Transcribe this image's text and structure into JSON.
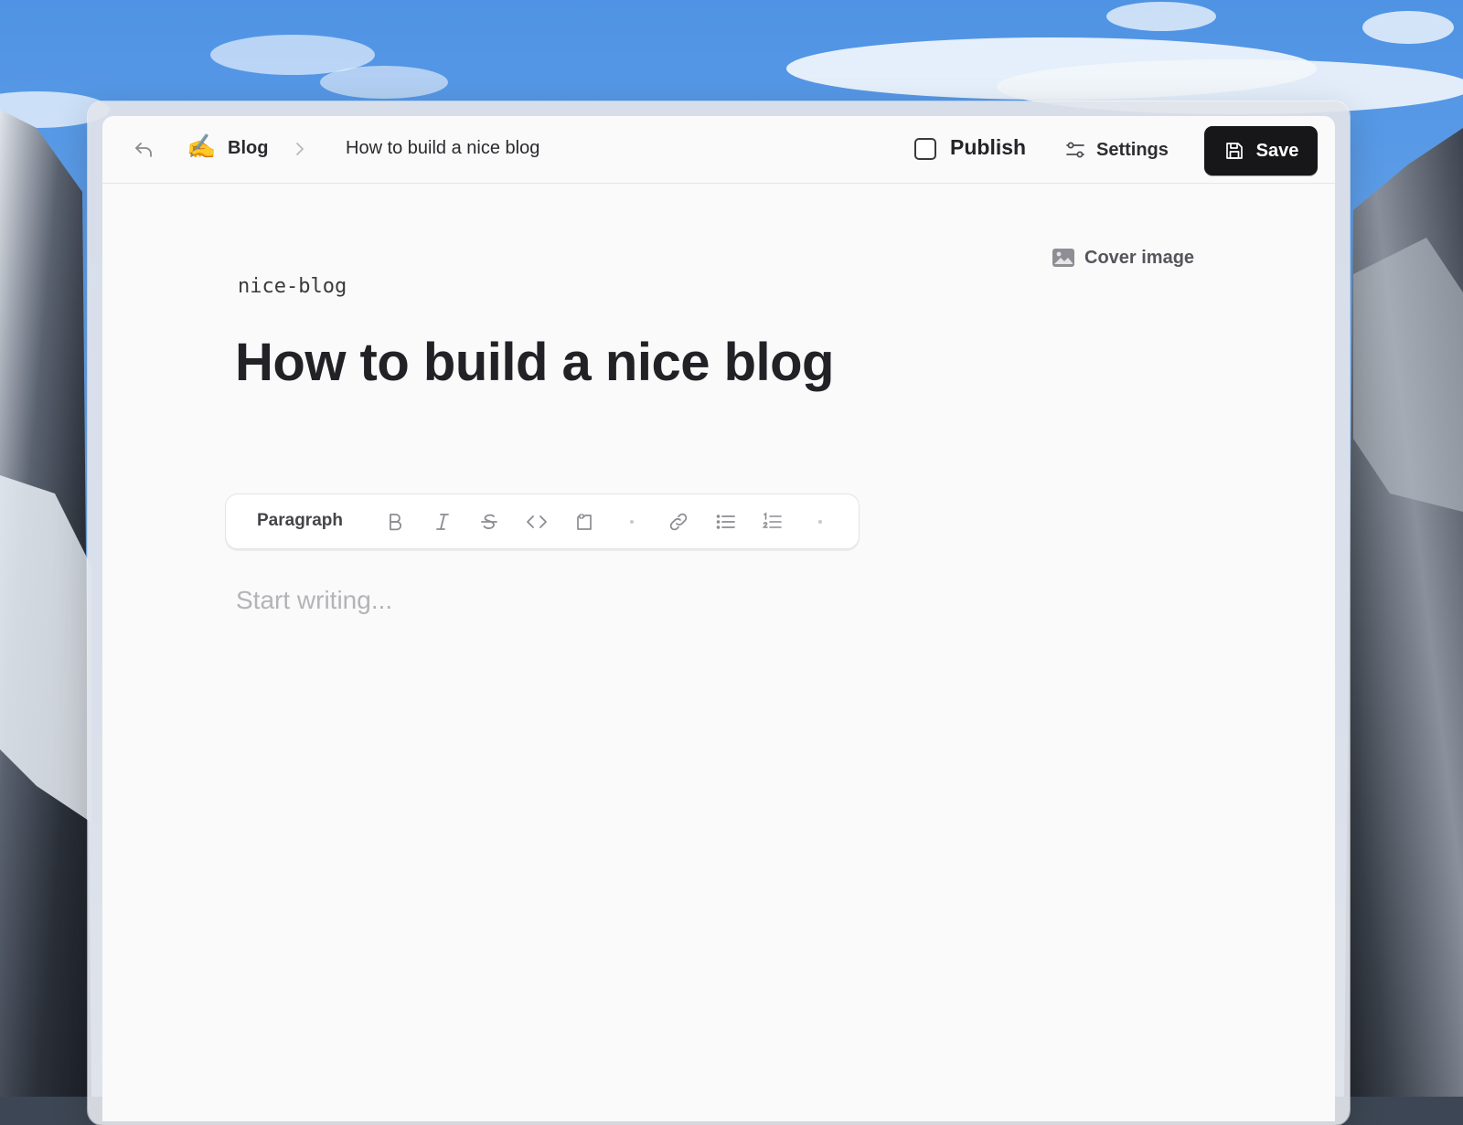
{
  "header": {
    "breadcrumb_emoji": "✍️",
    "breadcrumb_root": "Blog",
    "breadcrumb_current": "How to build a nice blog",
    "publish_label": "Publish",
    "publish_checked": false,
    "settings_label": "Settings",
    "save_label": "Save"
  },
  "editor": {
    "cover_image_label": "Cover image",
    "slug": "nice-blog",
    "title": "How to build a nice blog",
    "body_placeholder": "Start writing..."
  },
  "toolbar": {
    "block_type": "Paragraph",
    "tools": [
      "bold-icon",
      "italic-icon",
      "strikethrough-icon",
      "code-icon",
      "code-block-icon",
      "link-icon",
      "bullet-list-icon",
      "ordered-list-icon"
    ]
  },
  "colors": {
    "save_button_bg": "#17171a",
    "window_bg": "#fafafa",
    "placeholder": "#b3b3b8"
  }
}
